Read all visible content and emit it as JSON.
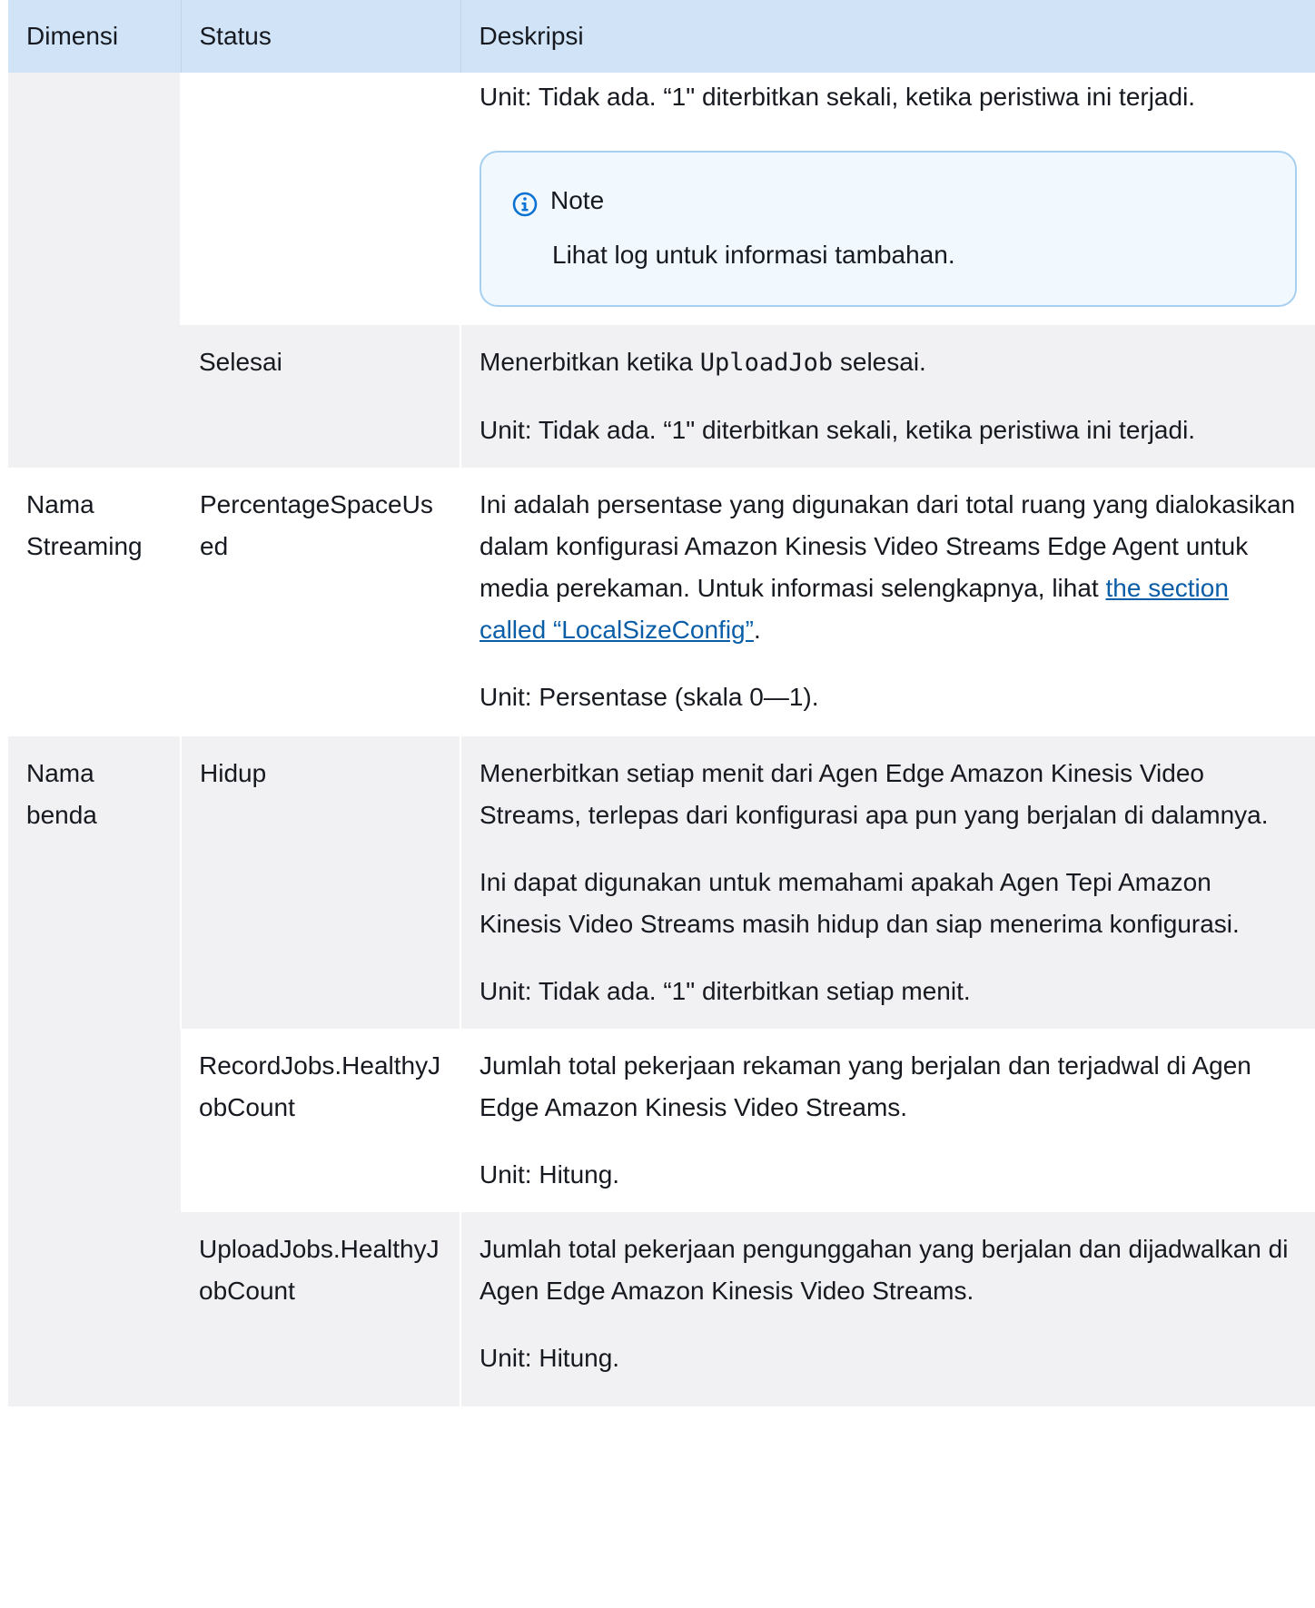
{
  "table": {
    "headers": [
      "Dimensi",
      "Status",
      "Deskripsi"
    ],
    "rows": [
      {
        "dimension": "",
        "status": "",
        "description": [
          "Unit: Tidak ada. “1\" diterbitkan sekali, ketika peristiwa ini terjadi."
        ],
        "note": {
          "title": "Note",
          "text": "Lihat log untuk informasi tambahan."
        }
      },
      {
        "dimension": "",
        "status": "Selesai",
        "description_pre": "Menerbitkan ketika ",
        "description_code": "UploadJob",
        "description_post": " selesai.",
        "description2": "Unit: Tidak ada. “1\" diterbitkan sekali, ketika peristiwa ini terjadi."
      },
      {
        "dimension": "Nama Streaming",
        "status": "PercentageSpaceUsed",
        "description_pre": "Ini adalah persentase yang digunakan dari total ruang yang dialokasikan dalam konfigurasi Amazon Kinesis Video Streams Edge Agent untuk media perekaman. Untuk informasi selengkapnya, lihat ",
        "description_link": "the section called “LocalSizeConfig”",
        "description_post": ".",
        "description2": "Unit: Persentase (skala 0—1)."
      },
      {
        "dimension": "Nama benda",
        "status": "Hidup",
        "description": [
          "Menerbitkan setiap menit dari Agen Edge Amazon Kinesis Video Streams, terlepas dari konfigurasi apa pun yang berjalan di dalamnya.",
          "Ini dapat digunakan untuk memahami apakah Agen Tepi Amazon Kinesis Video Streams masih hidup dan siap menerima konfigurasi.",
          "Unit: Tidak ada. “1\" diterbitkan setiap menit."
        ]
      },
      {
        "dimension": "",
        "status": "RecordJobs.HealthyJobCount",
        "description": [
          "Jumlah total pekerjaan rekaman yang berjalan dan terjadwal di Agen Edge Amazon Kinesis Video Streams.",
          "Unit: Hitung."
        ]
      },
      {
        "dimension": "",
        "status": "UploadJobs.HealthyJobCount",
        "description": [
          "Jumlah total pekerjaan pengunggahan yang berjalan dan dijadwalkan di Agen Edge Amazon Kinesis Video Streams.",
          "Unit: Hitung."
        ]
      }
    ]
  },
  "colors": {
    "header_bg": "#d1e4f7",
    "row_gray": "#f1f1f3",
    "note_border": "#a6d0f2",
    "note_bg": "#f1f8fe",
    "link": "#0a5ea8",
    "info_icon": "#0972d3"
  },
  "icons": {
    "note": "info-circle-icon"
  }
}
